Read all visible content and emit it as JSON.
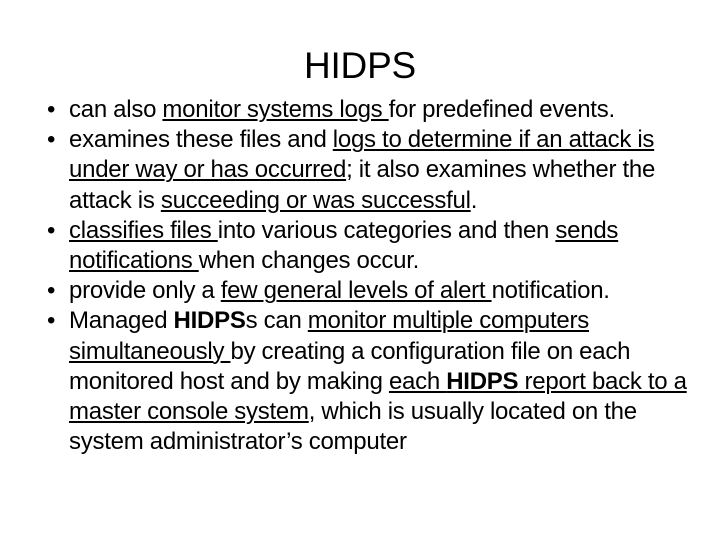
{
  "slide": {
    "title": "HIDPS",
    "background_color": "#ffffff",
    "text_color": "#000000",
    "bullet_glyph": "•",
    "bullets": [
      {
        "id": "bullet-monitor-system-logs",
        "plain_text": "can also monitor systems logs for predefined events.",
        "runs": [
          {
            "text": "can also ",
            "underline": false,
            "bold": false
          },
          {
            "text": "monitor systems logs ",
            "underline": true,
            "bold": false
          },
          {
            "text": "for predefined events.",
            "underline": false,
            "bold": false
          }
        ]
      },
      {
        "id": "bullet-examines-files-and-logs",
        "plain_text": "examines these files and logs to determine if an attack is under way or has occurred; it also examines whether the attack is succeeding or was successful.",
        "runs": [
          {
            "text": "examines these files and ",
            "underline": false,
            "bold": false
          },
          {
            "text": "logs to determine if an attack is under way or has occurred",
            "underline": true,
            "bold": false
          },
          {
            "text": "; it also examines whether the attack is ",
            "underline": false,
            "bold": false
          },
          {
            "text": "succeeding or was successful",
            "underline": true,
            "bold": false
          },
          {
            "text": ".",
            "underline": false,
            "bold": false
          }
        ]
      },
      {
        "id": "bullet-classifies-files",
        "plain_text": "classifies files into various categories and then sends notifications when changes occur.",
        "runs": [
          {
            "text": "classifies files ",
            "underline": true,
            "bold": false
          },
          {
            "text": "into various categories and then ",
            "underline": false,
            "bold": false
          },
          {
            "text": "sends notifications ",
            "underline": true,
            "bold": false
          },
          {
            "text": "when changes occur.",
            "underline": false,
            "bold": false
          }
        ]
      },
      {
        "id": "bullet-few-general-levels-of-alert",
        "plain_text": "provide only a few general levels of alert notification.",
        "runs": [
          {
            "text": "provide only a ",
            "underline": false,
            "bold": false
          },
          {
            "text": "few general levels of alert ",
            "underline": true,
            "bold": false
          },
          {
            "text": "notification.",
            "underline": false,
            "bold": false
          }
        ]
      },
      {
        "id": "bullet-managed-hidpss",
        "plain_text": "Managed HIDPSs can monitor multiple computers simultaneously by creating a configuration file on each monitored host and by making each HIDPS report back to a master console system, which is usually located on the system administrator’s computer",
        "runs": [
          {
            "text": "Managed ",
            "underline": false,
            "bold": false
          },
          {
            "text": "HIDPS",
            "underline": false,
            "bold": true
          },
          {
            "text": "s can ",
            "underline": false,
            "bold": false
          },
          {
            "text": "monitor multiple computers simultaneously ",
            "underline": true,
            "bold": false
          },
          {
            "text": "by creating a configuration file on each monitored host and by making ",
            "underline": false,
            "bold": false
          },
          {
            "text": "each ",
            "underline": true,
            "bold": false
          },
          {
            "text": "HIDPS",
            "underline": true,
            "bold": true
          },
          {
            "text": " report back to a master console system",
            "underline": true,
            "bold": false
          },
          {
            "text": ", which is usually located on the system administrator’s computer",
            "underline": false,
            "bold": false
          }
        ]
      }
    ]
  }
}
